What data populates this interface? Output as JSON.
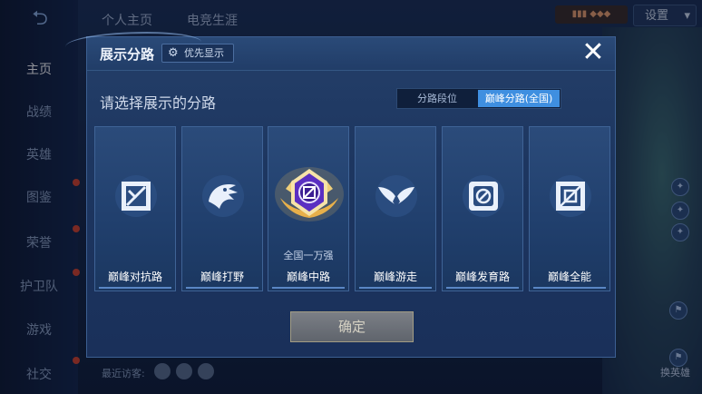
{
  "background": {
    "back_icon": "back-arrow-icon",
    "nav": [
      {
        "label": "主页",
        "active": true
      },
      {
        "label": "战绩",
        "active": false
      },
      {
        "label": "英雄",
        "active": false
      },
      {
        "label": "图鉴",
        "active": false,
        "dot": true
      },
      {
        "label": "荣誉",
        "active": false,
        "dot": true
      },
      {
        "label": "护卫队",
        "active": false,
        "dot": true
      },
      {
        "label": "游戏",
        "active": false
      },
      {
        "label": "社交",
        "active": false,
        "dot": true
      }
    ],
    "top_tabs": [
      "个人主页",
      "电竞生涯"
    ],
    "settings_label": "设置",
    "bottom_text": "最近访客:",
    "switch_hero_label": "换英雄"
  },
  "modal": {
    "title": "展示分路",
    "priority_label": "优先显示",
    "close_icon": "close-icon",
    "subtitle": "请选择展示的分路",
    "toggle": [
      "分路段位",
      "巅峰分路(全国)"
    ],
    "toggle_selected": 1,
    "cards": [
      {
        "label": "巅峰对抗路",
        "icon": "clash-lane-icon",
        "sub": ""
      },
      {
        "label": "巅峰打野",
        "icon": "jungle-icon",
        "sub": ""
      },
      {
        "label": "巅峰中路",
        "icon": "mid-lane-badge-icon",
        "sub": "全国一万强"
      },
      {
        "label": "巅峰游走",
        "icon": "roam-icon",
        "sub": ""
      },
      {
        "label": "巅峰发育路",
        "icon": "farm-lane-icon",
        "sub": ""
      },
      {
        "label": "巅峰全能",
        "icon": "all-round-icon",
        "sub": ""
      }
    ],
    "confirm_label": "确定"
  },
  "colors": {
    "accent_blue": "#3f8fe0",
    "modal_bg": "#1d3660",
    "badge_purple": "#5a2fc2",
    "badge_gold": "#e8b04a"
  }
}
